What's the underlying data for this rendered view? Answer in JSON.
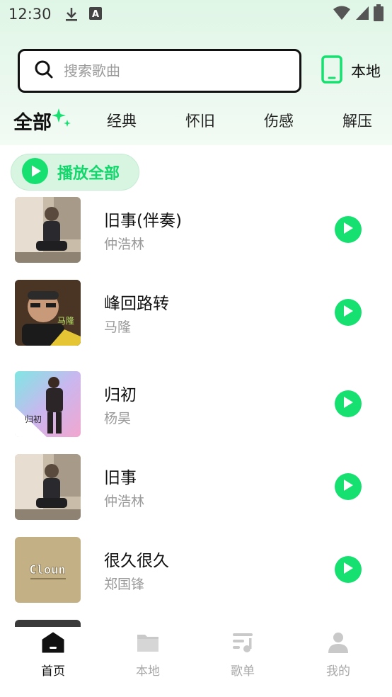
{
  "status_bar": {
    "time": "12:30",
    "icons": [
      "download-icon",
      "keyboard-a-icon",
      "wifi-icon",
      "signal-icon",
      "battery-icon"
    ]
  },
  "search": {
    "placeholder": "搜索歌曲",
    "value": ""
  },
  "local_button": {
    "label": "本地",
    "icon": "phone-icon"
  },
  "tabs": [
    {
      "label": "全部",
      "active": true
    },
    {
      "label": "经典",
      "active": false
    },
    {
      "label": "怀旧",
      "active": false
    },
    {
      "label": "伤感",
      "active": false
    },
    {
      "label": "解压",
      "active": false
    }
  ],
  "play_all": {
    "label": "播放全部"
  },
  "songs": [
    {
      "title": "旧事(伴奏)",
      "artist": "仲浩林"
    },
    {
      "title": "峰回路转",
      "artist": "马隆",
      "cover_text": "马隆"
    },
    {
      "title": "归初",
      "artist": "杨昊",
      "cover_text": "归初"
    },
    {
      "title": "旧事",
      "artist": "仲浩林"
    },
    {
      "title": "很久很久",
      "artist": "郑国锋",
      "cover_text": "Cloun"
    }
  ],
  "bottom_nav": [
    {
      "label": "首页",
      "icon": "home-icon",
      "active": true
    },
    {
      "label": "本地",
      "icon": "folder-icon",
      "active": false
    },
    {
      "label": "歌单",
      "icon": "playlist-icon",
      "active": false
    },
    {
      "label": "我的",
      "icon": "user-icon",
      "active": false
    }
  ],
  "colors": {
    "accent": "#16e070",
    "accent_text": "#12d86c",
    "header_bg": "#e4f7ea",
    "muted_text": "#9a9a9a"
  }
}
